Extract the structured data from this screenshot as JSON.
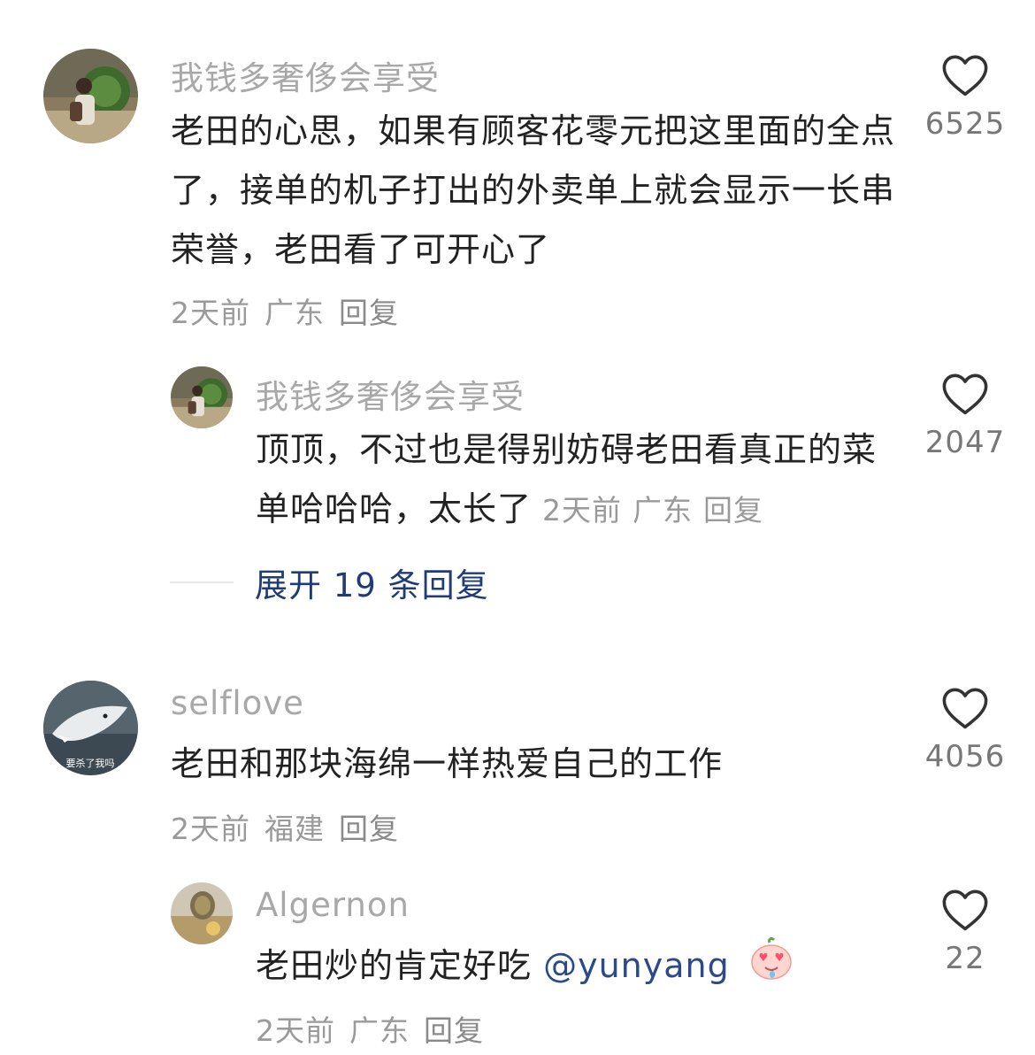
{
  "comments": [
    {
      "username": "我钱多奢侈会享受",
      "text": "老田的心思，如果有顾客花零元把这里面的全点了，接单的机子打出的外卖单上就会显示一长串荣誉，老田看了可开心了",
      "time": "2天前",
      "location": "广东",
      "reply_label": "回复",
      "likes": "6525",
      "reply": {
        "username": "我钱多奢侈会享受",
        "text": "顶顶，不过也是得别妨碍老田看真正的菜单哈哈哈，太长了",
        "time": "2天前",
        "location": "广东",
        "reply_label": "回复",
        "likes": "2047"
      },
      "expand_label": "展开 19 条回复"
    },
    {
      "username": "selflove",
      "avatar_caption": "要杀了我吗",
      "text": "老田和那块海绵一样热爱自己的工作",
      "time": "2天前",
      "location": "福建",
      "reply_label": "回复",
      "likes": "4056",
      "reply": {
        "username": "Algernon",
        "text": "老田炒的肯定好吃",
        "mention": "@yunyang",
        "emoji": "heart-eyes-peach-emoji",
        "time": "2天前",
        "location": "广东",
        "reply_label": "回复",
        "likes": "22"
      }
    }
  ],
  "colors": {
    "username": "#a8a8a8",
    "text": "#222222",
    "meta": "#9a9a9a",
    "expand_link": "#1f3c78",
    "mention": "#2c4a8a"
  },
  "icons": {
    "like": "heart-outline-icon"
  }
}
